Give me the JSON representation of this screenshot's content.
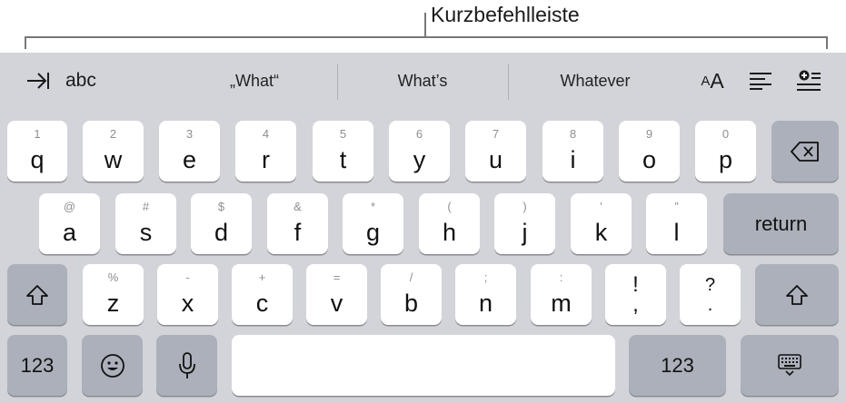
{
  "callout": {
    "label": "Kurzbefehlleiste"
  },
  "shortcut_bar": {
    "tab_icon": "tab-arrow-icon",
    "abc_label": "abc",
    "suggestions": [
      "„What“",
      "What’s",
      "Whatever"
    ],
    "text_size_label_small": "A",
    "text_size_label_big": "A",
    "align_icon": "align-left-icon",
    "insert_icon": "insert-plus-icon"
  },
  "keyboard": {
    "row1": [
      {
        "sec": "1",
        "pri": "q"
      },
      {
        "sec": "2",
        "pri": "w"
      },
      {
        "sec": "3",
        "pri": "e"
      },
      {
        "sec": "4",
        "pri": "r"
      },
      {
        "sec": "5",
        "pri": "t"
      },
      {
        "sec": "6",
        "pri": "y"
      },
      {
        "sec": "7",
        "pri": "u"
      },
      {
        "sec": "8",
        "pri": "i"
      },
      {
        "sec": "9",
        "pri": "o"
      },
      {
        "sec": "0",
        "pri": "p"
      }
    ],
    "row2": [
      {
        "sec": "@",
        "pri": "a"
      },
      {
        "sec": "#",
        "pri": "s"
      },
      {
        "sec": "$",
        "pri": "d"
      },
      {
        "sec": "&",
        "pri": "f"
      },
      {
        "sec": "*",
        "pri": "g"
      },
      {
        "sec": "(",
        "pri": "h"
      },
      {
        "sec": ")",
        "pri": "j"
      },
      {
        "sec": "’",
        "pri": "k"
      },
      {
        "sec": "”",
        "pri": "l"
      }
    ],
    "row3": [
      {
        "sec": "%",
        "pri": "z"
      },
      {
        "sec": "-",
        "pri": "x"
      },
      {
        "sec": "+",
        "pri": "c"
      },
      {
        "sec": "=",
        "pri": "v"
      },
      {
        "sec": "/",
        "pri": "b"
      },
      {
        "sec": ";",
        "pri": "n"
      },
      {
        "sec": ":",
        "pri": "m"
      },
      {
        "sec": "!",
        "pri": ","
      },
      {
        "sec": "?",
        "pri": "."
      }
    ],
    "return_label": "return",
    "numbers_label": "123",
    "backspace_icon": "backspace-icon",
    "shift_icon": "shift-icon",
    "emoji_icon": "emoji-icon",
    "mic_icon": "microphone-icon",
    "hide_keyboard_icon": "hide-keyboard-icon"
  }
}
